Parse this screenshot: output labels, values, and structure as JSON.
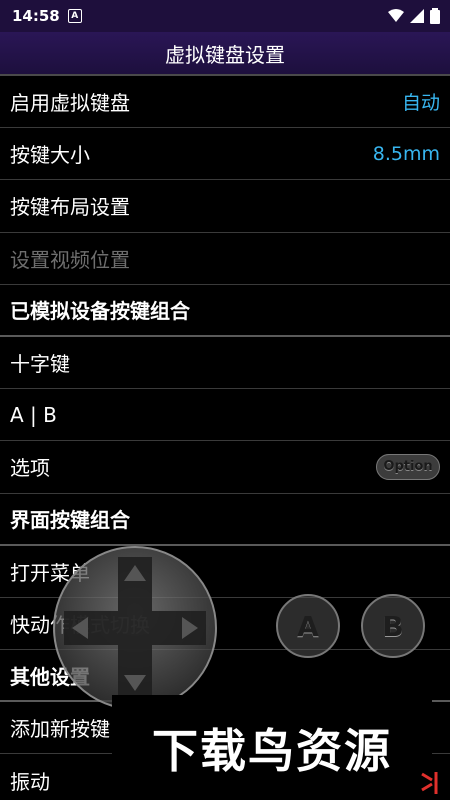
{
  "status_bar": {
    "time": "14:58",
    "notification": "A"
  },
  "title": "虚拟键盘设置",
  "rows": [
    {
      "label": "启用虚拟键盘",
      "value": "自动"
    },
    {
      "label": "按键大小",
      "value": "8.5mm"
    },
    {
      "label": "按键布局设置"
    },
    {
      "label": "设置视频位置"
    },
    {
      "label": "已模拟设备按键组合"
    },
    {
      "label": "十字键"
    },
    {
      "label": "A | B"
    },
    {
      "label": "选项",
      "button": "Option"
    },
    {
      "label": "界面按键组合"
    },
    {
      "label": "打开菜单"
    },
    {
      "label": "快动作模式切换"
    },
    {
      "label": "其他设置"
    },
    {
      "label": "添加新按键"
    },
    {
      "label": "振动"
    }
  ],
  "overlay": {
    "button_a": "A",
    "button_b": "B"
  },
  "watermark": "下载鸟资源",
  "colors": {
    "accent": "#38b6f0",
    "title_bg": "#1e0f3c",
    "disabled": "#6e6e6e"
  }
}
